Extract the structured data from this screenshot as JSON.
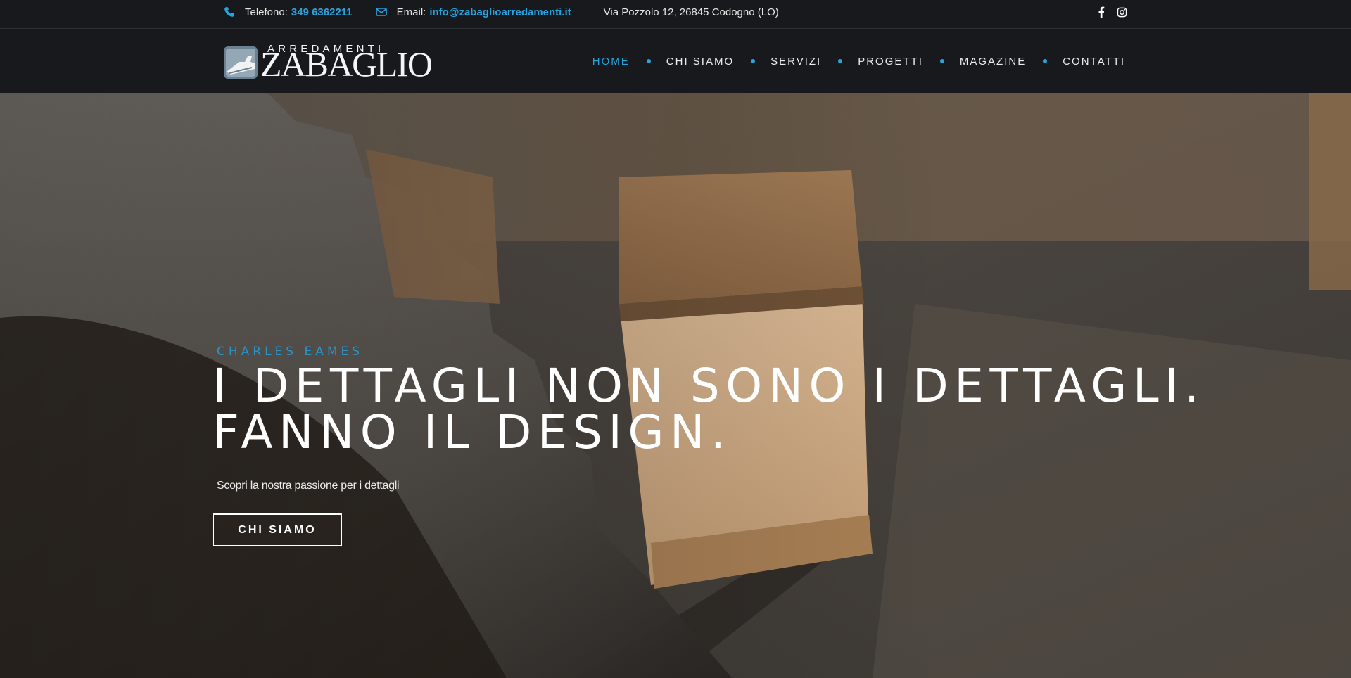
{
  "topbar": {
    "phone_label": "Telefono:",
    "phone_value": "349 6362211",
    "email_label": "Email:",
    "email_value": "info@zabaglioarredamenti.it",
    "address": "Via Pozzolo 12, 26845 Codogno (LO)",
    "icons": [
      "phone-icon",
      "envelope-icon",
      "facebook-icon",
      "instagram-icon"
    ]
  },
  "header": {
    "logo_small": "ARREDAMENTI",
    "logo_big": "ZABAGLIO",
    "nav": [
      {
        "label": "HOME",
        "active": true
      },
      {
        "label": "CHI SIAMO",
        "active": false
      },
      {
        "label": "SERVIZI",
        "active": false
      },
      {
        "label": "PROGETTI",
        "active": false
      },
      {
        "label": "MAGAZINE",
        "active": false
      },
      {
        "label": "CONTATTI",
        "active": false
      }
    ]
  },
  "hero": {
    "eyebrow": "CHARLES EAMES",
    "headline_line1": "I DETTAGLI NON SONO I DETTAGLI.",
    "headline_line2": "FANNO IL DESIGN.",
    "subtitle": "Scopri la nostra passione per i dettagli",
    "cta_label": "CHI SIAMO"
  },
  "colors": {
    "accent": "#27a3de",
    "bar_background": "#18191c",
    "text_light": "#ffffff"
  }
}
